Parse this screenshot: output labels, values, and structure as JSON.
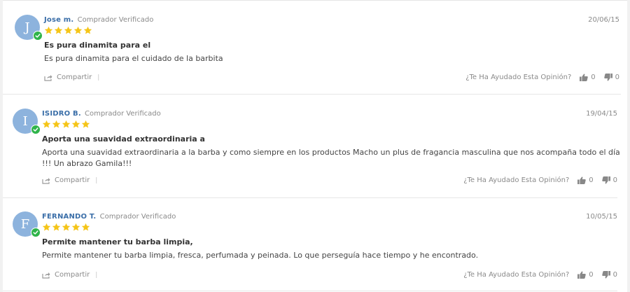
{
  "colors": {
    "accent": "#3a6ea8",
    "avatar": "#8db3dd",
    "verified": "#2fb44a",
    "star": "#f5c518",
    "muted": "#8a8a8a"
  },
  "icons": {
    "star": "star-icon",
    "verified": "check-icon",
    "share": "share-icon",
    "thumbs_up": "thumbs-up-icon",
    "thumbs_down": "thumbs-down-icon"
  },
  "reviews": [
    {
      "initial": "J",
      "name": "Jose m.",
      "buyer_label": "Comprador Verificado",
      "date": "20/06/15",
      "rating": 5,
      "title": "Es pura dinamita para el",
      "body": "Es pura dinamita para el cuidado de la barbita",
      "share_label": "Compartir",
      "pipe": "|",
      "helpful_question": "¿Te Ha Ayudado Esta Opinión?",
      "up_count": "0",
      "down_count": "0"
    },
    {
      "initial": "I",
      "name": "ISIDRO B.",
      "buyer_label": "Comprador Verificado",
      "date": "19/04/15",
      "rating": 5,
      "title": "Aporta una suavidad extraordinaria a",
      "body": "Aporta una suavidad extraordinaria a la barba y como siempre en los productos Macho un plus de fragancia masculina que nos acompaña todo el día !!! Un abrazo Gamila!!!",
      "share_label": "Compartir",
      "pipe": "|",
      "helpful_question": "¿Te Ha Ayudado Esta Opinión?",
      "up_count": "0",
      "down_count": "0"
    },
    {
      "initial": "F",
      "name": "FERNANDO T.",
      "buyer_label": "Comprador Verificado",
      "date": "10/05/15",
      "rating": 5,
      "title": "Permite mantener tu barba limpia,",
      "body": "Permite mantener tu barba limpia, fresca, perfumada y peinada. Lo que perseguía hace tiempo y he encontrado.",
      "share_label": "Compartir",
      "pipe": "|",
      "helpful_question": "¿Te Ha Ayudado Esta Opinión?",
      "up_count": "0",
      "down_count": "0"
    }
  ]
}
